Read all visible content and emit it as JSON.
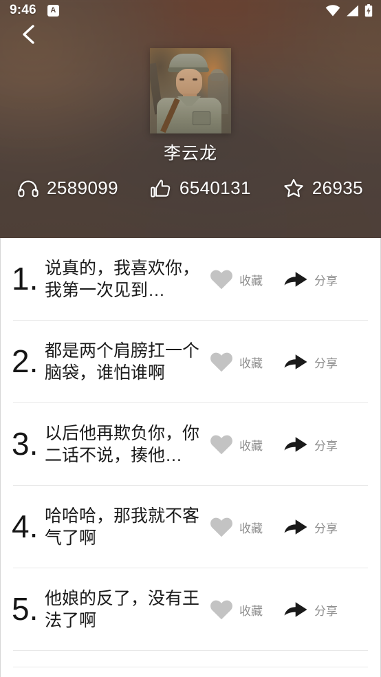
{
  "status_bar": {
    "time": "9:46",
    "notification_badge": "A",
    "icons": [
      "wifi-icon",
      "cellular-signal-icon",
      "battery-charging-icon"
    ]
  },
  "header": {
    "back_icon": "chevron-left-icon",
    "avatar_alt": "portrait of a soldier in grey-green military uniform and cap",
    "profile_name": "李云龙",
    "stats": [
      {
        "icon": "headphones-icon",
        "value": "2589099",
        "name": "plays"
      },
      {
        "icon": "thumbs-up-icon",
        "value": "6540131",
        "name": "likes"
      },
      {
        "icon": "star-icon",
        "value": "26935",
        "name": "favorites"
      }
    ]
  },
  "actions": {
    "favorite_label": "收藏",
    "favorite_icon": "heart-icon",
    "share_label": "分享",
    "share_icon": "share-arrow-icon"
  },
  "colors": {
    "heart": "#c3c3c3",
    "share_arrow": "#1a1a1a",
    "action_label": "#8e8e8e",
    "quote_text": "#1b1b1b",
    "divider": "#e8e8e8",
    "card_bg": "#ffffff"
  },
  "list": {
    "items": [
      {
        "rank": "1",
        "dot": ".",
        "text": "说真的，我喜欢你，我第一次见到…"
      },
      {
        "rank": "2",
        "dot": ".",
        "text": "都是两个肩膀扛一个脑袋，谁怕谁啊"
      },
      {
        "rank": "3",
        "dot": ".",
        "text": "以后他再欺负你，你二话不说，揍他…"
      },
      {
        "rank": "4",
        "dot": ".",
        "text": "哈哈哈，那我就不客气了啊"
      },
      {
        "rank": "5",
        "dot": ".",
        "text": "他娘的反了，没有王法了啊"
      }
    ]
  }
}
